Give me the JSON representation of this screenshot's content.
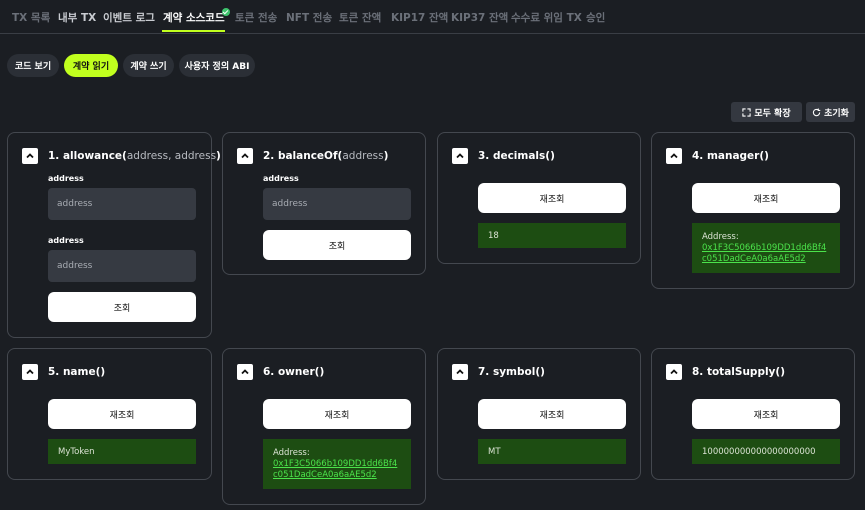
{
  "tabs": [
    {
      "label": "TX 목록"
    },
    {
      "label": "내부 TX"
    },
    {
      "label": "이벤트 로그"
    },
    {
      "label": "계약 소스코드"
    },
    {
      "label": "토큰 전송"
    },
    {
      "label": "NFT 전송"
    },
    {
      "label": "토큰 잔액"
    },
    {
      "label": "KIP17 잔액"
    },
    {
      "label": "KIP37 잔액"
    },
    {
      "label": "수수료 위임 TX"
    },
    {
      "label": "승인"
    }
  ],
  "active_tab": "계약 소스코드",
  "verified_icon": "check-circle-icon",
  "sub_tabs": [
    {
      "label": "코드 보기"
    },
    {
      "label": "계약 읽기"
    },
    {
      "label": "계약 쓰기"
    },
    {
      "label": "사용자 정의 ABI"
    }
  ],
  "active_sub_tab": "계약 읽기",
  "tools": {
    "expand_all": "모두 확장",
    "reset": "초기화"
  },
  "functions": [
    {
      "title": "1. allowance(",
      "params": "address, address",
      "close": ")",
      "inputs": [
        {
          "label": "address",
          "placeholder": "address"
        },
        {
          "label": "address",
          "placeholder": "address"
        }
      ],
      "button": "조회"
    },
    {
      "title": "2. balanceOf(",
      "params": "address",
      "close": ")",
      "inputs": [
        {
          "label": "address",
          "placeholder": "address"
        }
      ],
      "button": "조회"
    },
    {
      "title": "3. decimals()",
      "button": "재조회",
      "result": "18"
    },
    {
      "title": "4. manager()",
      "button": "재조회",
      "result_label": "Address:",
      "result_link": "0x1F3C5066b109DD1dd6Bf4c051DadCeA0a6aAE5d2"
    },
    {
      "title": "5. name()",
      "button": "재조회",
      "result": "MyToken"
    },
    {
      "title": "6. owner()",
      "button": "재조회",
      "result_label": "Address:",
      "result_link": "0x1F3C5066b109DD1dd6Bf4c051DadCeA0a6aAE5d2"
    },
    {
      "title": "7. symbol()",
      "button": "재조회",
      "result": "MT"
    },
    {
      "title": "8. totalSupply()",
      "button": "재조회",
      "result": "100000000000000000000"
    }
  ],
  "colors": {
    "accent": "#c1ff1e",
    "result_bg": "#1d4d12",
    "link": "#4be34b",
    "background": "#1b1e23"
  }
}
